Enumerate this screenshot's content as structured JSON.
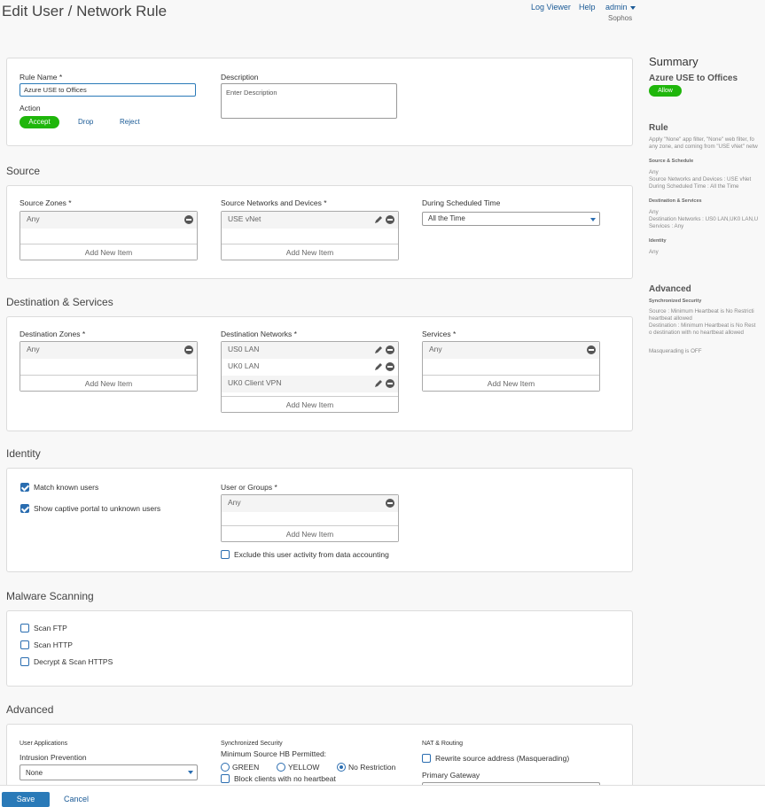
{
  "header": {
    "title": "Edit User / Network Rule",
    "log_viewer": "Log Viewer",
    "help": "Help",
    "user": "admin",
    "org": "Sophos"
  },
  "rule": {
    "name_label": "Rule Name *",
    "name_value": "Azure USE to Offices",
    "description_label": "Description",
    "description_placeholder": "Enter Description",
    "action_label": "Action",
    "actions": [
      "Accept",
      "Drop",
      "Reject"
    ]
  },
  "source": {
    "title": "Source",
    "zones_label": "Source Zones *",
    "zones": [
      "Any"
    ],
    "networks_label": "Source Networks and Devices *",
    "networks": [
      "USE vNet"
    ],
    "schedule_label": "During Scheduled Time",
    "schedule_value": "All the Time",
    "add_new": "Add New Item"
  },
  "destination": {
    "title": "Destination & Services",
    "zones_label": "Destination Zones *",
    "zones": [
      "Any"
    ],
    "networks_label": "Destination Networks *",
    "networks": [
      "US0 LAN",
      "UK0 LAN",
      "UK0 Client VPN"
    ],
    "services_label": "Services *",
    "services": [
      "Any"
    ],
    "add_new": "Add New Item"
  },
  "identity": {
    "title": "Identity",
    "match_known": "Match known users",
    "captive_portal": "Show captive portal to unknown users",
    "groups_label": "User or Groups *",
    "groups": [
      "Any"
    ],
    "add_new": "Add New Item",
    "exclude": "Exclude this user activity from data accounting"
  },
  "malware": {
    "title": "Malware Scanning",
    "scan_ftp": "Scan FTP",
    "scan_http": "Scan HTTP",
    "scan_https": "Decrypt & Scan HTTPS"
  },
  "advanced": {
    "title": "Advanced",
    "user_apps": "User Applications",
    "ips_label": "Intrusion Prevention",
    "ips_value": "None",
    "sync_sec": "Synchronized Security",
    "min_hb": "Minimum Source HB Permitted:",
    "hb_options": [
      "GREEN",
      "YELLOW",
      "No Restriction"
    ],
    "block_no_hb": "Block clients with no heartbeat",
    "nat": "NAT & Routing",
    "masq": "Rewrite source address (Masquerading)",
    "gateway": "Primary Gateway"
  },
  "summary": {
    "title": "Summary",
    "name": "Azure USE to Offices",
    "badge": "Allow",
    "rule_h": "Rule",
    "rule_text_1": "Apply \"None\" app filter, \"None\" web filter, fo",
    "rule_text_2": "any zone, and coming from \"USE vNet\" netw",
    "src_h": "Source & Schedule",
    "src_1": "Any",
    "src_2": "Source Networks and Devices : USE vNet",
    "src_3": "During Scheduled Time : All the Time",
    "dst_h": "Destination & Services",
    "dst_1": "Any",
    "dst_2": "Destination Networks : US0 LAN,UK0 LAN,U",
    "dst_3": "Services : Any",
    "id_h": "Identity",
    "id_1": "Any",
    "adv_h": "Advanced",
    "sync_h": "Synchronized Security",
    "sync_1": "Source : Minimum Heartbeat is No Restricti",
    "sync_2": "heartbeat allowed",
    "sync_3": "Destination : Minimum Heartbeat is No Rest",
    "sync_4": "o destination with no heartbeat allowed",
    "masq": "Masquerading is OFF"
  },
  "footer": {
    "save": "Save",
    "cancel": "Cancel"
  }
}
